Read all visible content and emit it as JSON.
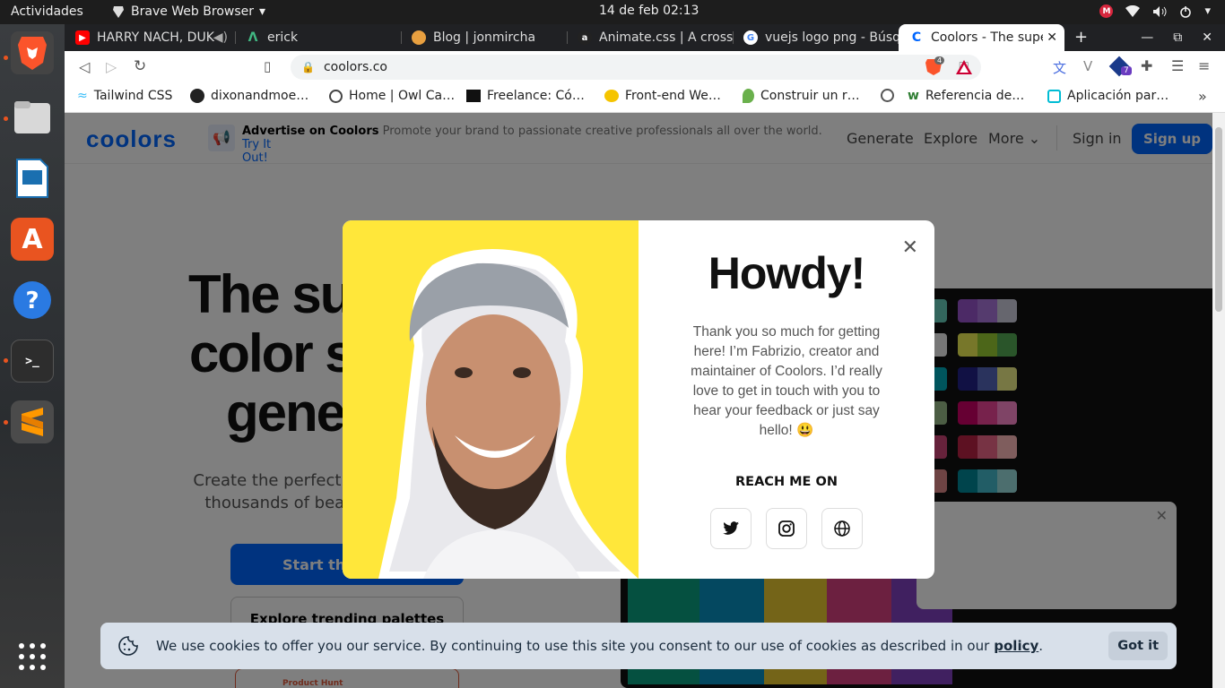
{
  "topbar": {
    "activities": "Actividades",
    "app_name": "Brave Web Browser",
    "clock": "14 de feb  02:13",
    "mail_badge": "M"
  },
  "dock": {
    "icons": [
      "brave-browser",
      "files",
      "libreoffice-impress",
      "ubuntu-software",
      "help",
      "terminal",
      "sublime-text",
      "show-applications"
    ]
  },
  "tabs": [
    {
      "title": "HARRY NACH, DUK",
      "favicon_color": "#ff0000"
    },
    {
      "title": "erick",
      "favicon_color": "#41b883"
    },
    {
      "title": "Blog | jonmircha",
      "favicon_color": "#e8a040"
    },
    {
      "title": "Animate.css | A cross-",
      "favicon_color": "#222222"
    },
    {
      "title": "vuejs logo png - Búsq",
      "favicon_color": "#4285f4"
    },
    {
      "title": "Coolors - The supe",
      "favicon_color": "#0066ff"
    }
  ],
  "toolbar": {
    "url": "coolors.co",
    "brave_shield_count": "4",
    "extension_badge": "7"
  },
  "bookmarks": [
    {
      "label": "Tailwind CSS",
      "color": "#38bdf8"
    },
    {
      "label": "dixonandmoe…",
      "color": "#222222"
    },
    {
      "label": "Home | Owl Ca…",
      "color": "#444444"
    },
    {
      "label": "Freelance: Có…",
      "color": "#111111"
    },
    {
      "label": "Front-end We…",
      "color": "#f5c400"
    },
    {
      "label": "Construir un r…",
      "color": "#6ab04c"
    },
    {
      "label": "",
      "color": "#555555"
    },
    {
      "label": "Referencia de…",
      "color": "#2e7d32"
    },
    {
      "label": "Aplicación par…",
      "color": "#00bcd4"
    }
  ],
  "coolors": {
    "logo": "coolors",
    "ad_title": "Advertise on Coolors",
    "ad_text": "Promote your brand to passionate creative professionals all over the world.",
    "ad_link_1": "Try It",
    "ad_link_2": "Out!",
    "nav": {
      "generate": "Generate",
      "explore": "Explore",
      "more": "More",
      "signin": "Sign in",
      "signup": "Sign up"
    },
    "hero_line1": "The sup",
    "hero_line2": "color sc",
    "hero_line3": "gene",
    "sub_line1": "Create the perfect pa",
    "sub_line2": "thousands of beau",
    "start_button": "Start the",
    "explore_button": "Explore trending palettes",
    "product_hunt": "Product Hunt"
  },
  "modal": {
    "title": "Howdy!",
    "message": "Thank you so much for getting here! I’m Fabrizio, creator and maintainer of Coolors. I’d really love to get in touch with you to hear your feedback or just say hello! 😃",
    "reach_label": "REACH ME ON",
    "socials": [
      "twitter-icon",
      "instagram-icon",
      "globe-icon"
    ]
  },
  "cookie": {
    "text": "We use cookies to offer you our service. By continuing to use this site you consent to our use of cookies as described in our",
    "link": "policy",
    "period": ".",
    "button": "Got it"
  }
}
